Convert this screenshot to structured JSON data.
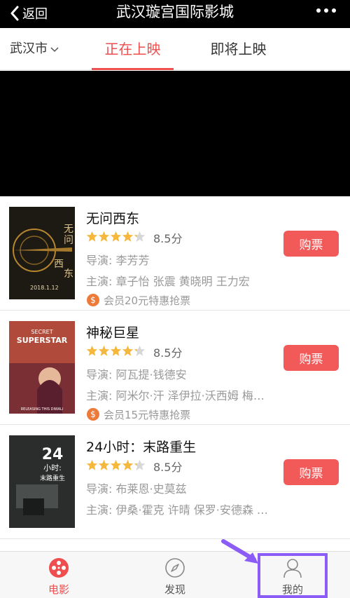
{
  "header": {
    "back_label": "返回",
    "title": "武汉璇宫国际影城"
  },
  "tabs": {
    "city": "武汉市",
    "now_showing": "正在上映",
    "coming_soon": "即将上映"
  },
  "movies": [
    {
      "name": "无问西东",
      "rating": 8.5,
      "score_label": "8.5分",
      "director": "导演: 李芳芳",
      "cast": "主演: 章子怡 张震 黄晓明 王力宏",
      "promo": "会员20元特惠抢票",
      "buy_label": "购票",
      "poster_texts": [
        "无",
        "问",
        "西",
        "东",
        "2018.1.12"
      ]
    },
    {
      "name": "神秘巨星",
      "rating": 8.5,
      "score_label": "8.5分",
      "director": "导演: 阿瓦提·钱德安",
      "cast": "主演: 阿米尔·汗 泽伊拉·沃西姆 梅…",
      "promo": "会员15元特惠抢票",
      "buy_label": "购票",
      "poster_texts": [
        "SECRET",
        "SUPERSTAR",
        "RELEASING THIS DIWALI"
      ]
    },
    {
      "name": "24小时：末路重生",
      "rating": 8.5,
      "score_label": "8.5分",
      "director": "导演: 布莱恩·史莫兹",
      "cast": "主演: 伊桑·霍克 许晴 保罗·安德森 …",
      "buy_label": "购票",
      "poster_texts": [
        "24",
        "小时:",
        "末路重生"
      ]
    }
  ],
  "promo_symbol": "$",
  "bottom_nav": [
    {
      "label": "电影",
      "icon": "film-reel-icon",
      "active": true
    },
    {
      "label": "发现",
      "icon": "compass-icon",
      "active": false
    },
    {
      "label": "我的",
      "icon": "user-icon",
      "active": false
    }
  ],
  "colors": {
    "accent": "#ef4e4e",
    "buy_button": "#f25a5a",
    "star": "#f5b83d",
    "highlight_box": "#8b5cf6",
    "coin": "#ee7a3a"
  }
}
